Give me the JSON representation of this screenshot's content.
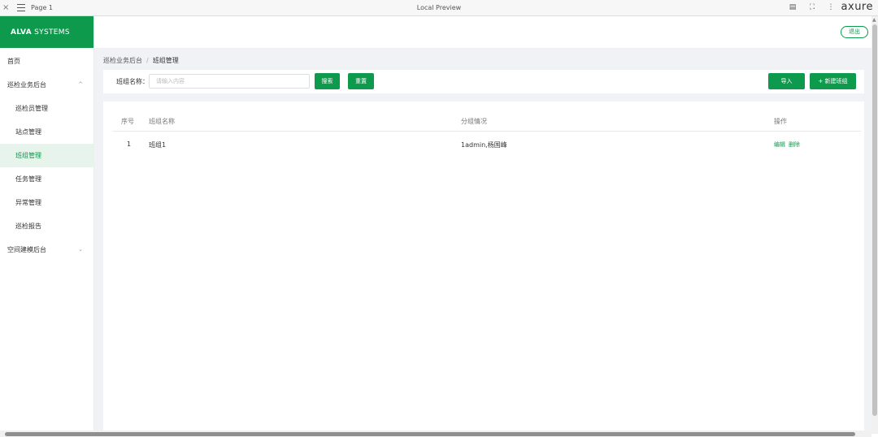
{
  "browser": {
    "page_name": "Page 1",
    "title": "Local Preview",
    "brand": "axure"
  },
  "sidebar": {
    "logo_bold": "ALVA",
    "logo_thin": " SYSTEMS",
    "items": [
      {
        "label": "首页",
        "level": "top"
      },
      {
        "label": "巡检业务后台",
        "level": "top",
        "chevron": "^"
      },
      {
        "label": "巡检员管理",
        "level": "sub"
      },
      {
        "label": "站点管理",
        "level": "sub"
      },
      {
        "label": "班组管理",
        "level": "sub",
        "active": true
      },
      {
        "label": "任务管理",
        "level": "sub"
      },
      {
        "label": "异常管理",
        "level": "sub"
      },
      {
        "label": "巡检报告",
        "level": "sub"
      },
      {
        "label": "空间建模后台",
        "level": "top",
        "chevron": "v"
      }
    ]
  },
  "header": {
    "logout_label": "退出"
  },
  "breadcrumb": {
    "parent": "巡检业务后台",
    "separator": "/",
    "current": "班组管理"
  },
  "filter": {
    "label": "班组名称：",
    "placeholder": "请输入内容",
    "search_label": "搜索",
    "reset_label": "重置",
    "import_label": "导入",
    "add_label": "+ 新建班组"
  },
  "table": {
    "columns": [
      "序号",
      "班组名称",
      "分组情况",
      "操作"
    ],
    "rows": [
      {
        "index": "1",
        "name": "班组1",
        "members": "1admin,杨国峰",
        "op_edit": "编辑",
        "op_delete": "删除"
      }
    ]
  },
  "colors": {
    "accent": "#0d9a4d",
    "active_bg": "#e6f4ec",
    "content_bg": "#f0f2f5"
  }
}
